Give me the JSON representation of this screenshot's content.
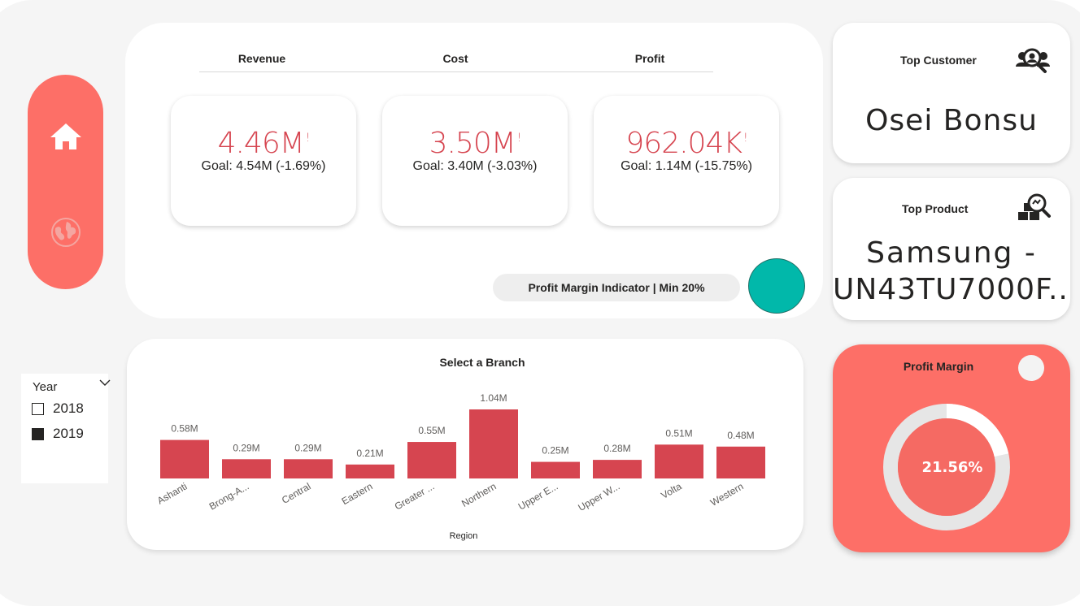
{
  "colors": {
    "accent": "#fd6f67",
    "kpi_red": "#d64550",
    "bar_red": "#d64550",
    "teal": "#01b8aa",
    "donut_ring": "#e6e6e6",
    "donut_fill": "#ffffff",
    "donut_center": "#f56a63"
  },
  "nav": {
    "items": [
      {
        "icon": "home-icon",
        "active": true
      },
      {
        "icon": "globe-icon",
        "active": false
      }
    ]
  },
  "kpis": {
    "revenue": {
      "header": "Revenue",
      "value": "4.46M",
      "flag": "!",
      "goal": "Goal: 4.54M (-1.69%)"
    },
    "cost": {
      "header": "Cost",
      "value": "3.50M",
      "flag": "!",
      "goal": "Goal: 3.40M (-3.03%)"
    },
    "profit": {
      "header": "Profit",
      "value": "962.04K",
      "flag": "!",
      "goal": "Goal: 1.14M (-15.75%)"
    }
  },
  "profit_margin_indicator": {
    "label": "Profit Margin Indicator | Min 20%",
    "status_color": "#01b8aa"
  },
  "top_customer": {
    "title": "Top Customer",
    "value": "Osei Bonsu",
    "icon": "user-search-icon"
  },
  "top_product": {
    "title": "Top Product",
    "value_line1": "Samsung -",
    "value_line2": "UN43TU7000F...",
    "icon": "product-search-icon"
  },
  "year_slicer": {
    "title": "Year",
    "options": [
      {
        "label": "2018",
        "checked": false
      },
      {
        "label": "2019",
        "checked": true
      }
    ]
  },
  "chart_data": {
    "type": "bar",
    "title": "Select a Branch",
    "xlabel": "Region",
    "ylabel": "",
    "categories": [
      "Ashanti",
      "Brong-A...",
      "Central",
      "Eastern",
      "Greater ...",
      "Northern",
      "Upper E...",
      "Upper W...",
      "Volta",
      "Western"
    ],
    "values": [
      0.58,
      0.29,
      0.29,
      0.21,
      0.55,
      1.04,
      0.25,
      0.28,
      0.51,
      0.48
    ],
    "data_labels": [
      "0.58M",
      "0.29M",
      "0.29M",
      "0.21M",
      "0.55M",
      "1.04M",
      "0.25M",
      "0.28M",
      "0.51M",
      "0.48M"
    ],
    "ylim": [
      0,
      1.04
    ],
    "grid": false,
    "legend": "none"
  },
  "profit_margin": {
    "title": "Profit Margin",
    "value_text": "21.56%",
    "fraction": 0.2156
  }
}
